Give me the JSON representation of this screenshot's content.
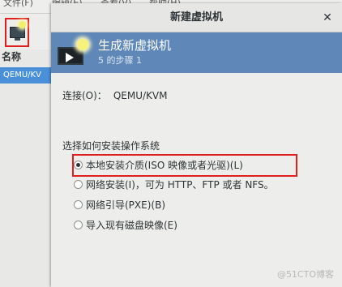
{
  "main_window": {
    "menu": [
      "文件(F)",
      "编辑(E)",
      "查看(V)",
      "帮助(H)"
    ],
    "list_header": "名称",
    "list_row": "QEMU/KV"
  },
  "dialog": {
    "title": "新建虚拟机",
    "close_glyph": "✕",
    "banner_title": "生成新虚拟机",
    "banner_step": "5 的步骤 1",
    "connection_label": "连接(O)：",
    "connection_value": "QEMU/KVM",
    "section_label": "选择如何安装操作系统",
    "options": [
      {
        "label": "本地安装介质(ISO 映像或者光驱)(L)",
        "checked": true
      },
      {
        "label": "网络安装(I)，可为 HTTP、FTP 或者 NFS。",
        "checked": false
      },
      {
        "label": "网络引导(PXE)(B)",
        "checked": false
      },
      {
        "label": "导入现有磁盘映像(E)",
        "checked": false
      }
    ]
  },
  "watermark": "@51CTO博客",
  "colors": {
    "accent": "#5f88b8",
    "selection": "#4a90d9",
    "highlight": "#e02020"
  },
  "icons": {
    "new_vm": "monitor-star-icon",
    "banner": "monitor-play-icon",
    "close": "close-icon"
  }
}
